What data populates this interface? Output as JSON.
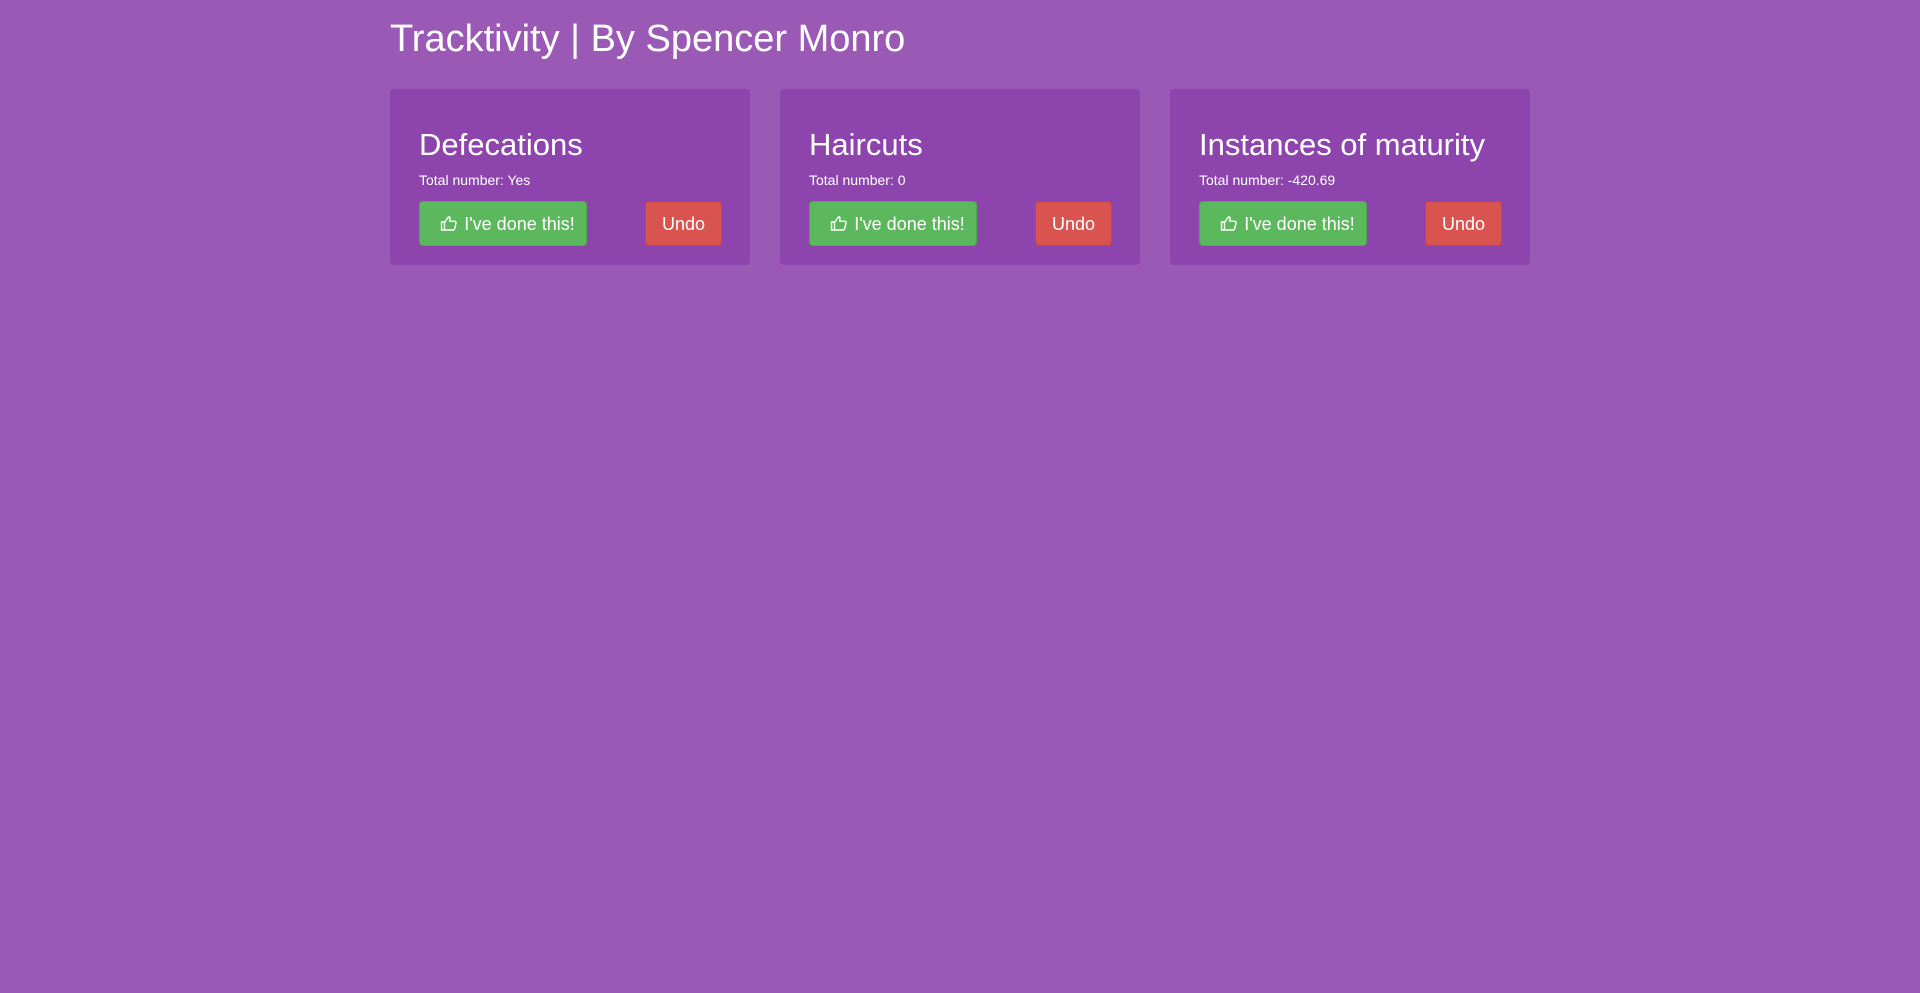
{
  "header": {
    "title": "Tracktivity | By Spencer Monro"
  },
  "cards": [
    {
      "title": "Defecations",
      "total": "Total number: Yes",
      "done_label": "I've done this!",
      "undo_label": "Undo",
      "done_icon": "thumbs-up-icon"
    },
    {
      "title": "Haircuts",
      "total": "Total number: 0",
      "done_label": "I've done this!",
      "undo_label": "Undo",
      "done_icon": "thumbs-up-icon"
    },
    {
      "title": "Instances of maturity",
      "total": "Total number: -420.69",
      "done_label": "I've done this!",
      "undo_label": "Undo",
      "done_icon": "thumbs-up-icon"
    }
  ],
  "colors": {
    "background": "#9b59b6",
    "card": "#8e44ad",
    "success": "#5cb85c",
    "danger": "#d9534f",
    "text": "#ffffff"
  }
}
